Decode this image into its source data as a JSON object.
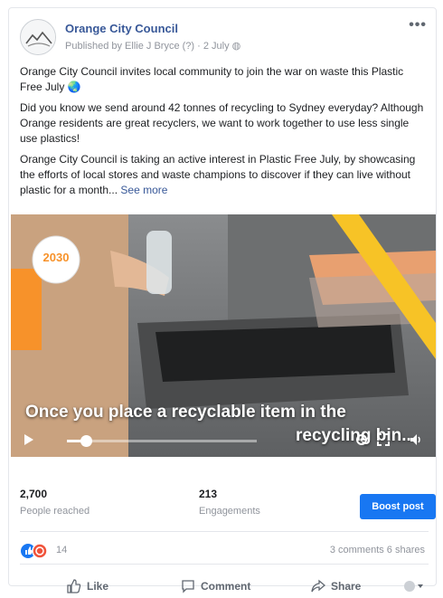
{
  "post": {
    "page_name": "Orange City Council",
    "published_by": "Published by Ellie J Bryce",
    "date": "2 July",
    "more_label": "•••",
    "paragraphs": [
      "Orange City Council invites local community to join the war on waste this Plastic Free July 🌏",
      "Did you know we send around 42 tonnes of recycling to Sydney everyday? Although Orange residents are great recyclers, we want to work together to use less single use plastics!",
      "Orange City Council is taking an active interest in Plastic Free July, by showcasing the efforts of local stores and waste champions to discover if they can live without plastic for a month..."
    ],
    "see_more": "See more"
  },
  "video": {
    "logo_text": "2030",
    "caption_line1": "Once you place a recyclable item in the",
    "caption_line2": "recycling bin...",
    "progress_fraction": 0.1
  },
  "stats": {
    "reached_value": "2,700",
    "reached_label": "People reached",
    "engagements_value": "213",
    "engagements_label": "Engagements",
    "boost_label": "Boost post"
  },
  "reactions": {
    "count": "14",
    "comments_shares": "3 comments 6 shares"
  },
  "actions": {
    "like": "Like",
    "comment": "Comment",
    "share": "Share"
  },
  "colors": {
    "accent": "#385898",
    "boost": "#1877f2",
    "bin_lid": "#e8a070",
    "highlight_orange": "#f7922a",
    "yellow_pole": "#f7c326"
  }
}
